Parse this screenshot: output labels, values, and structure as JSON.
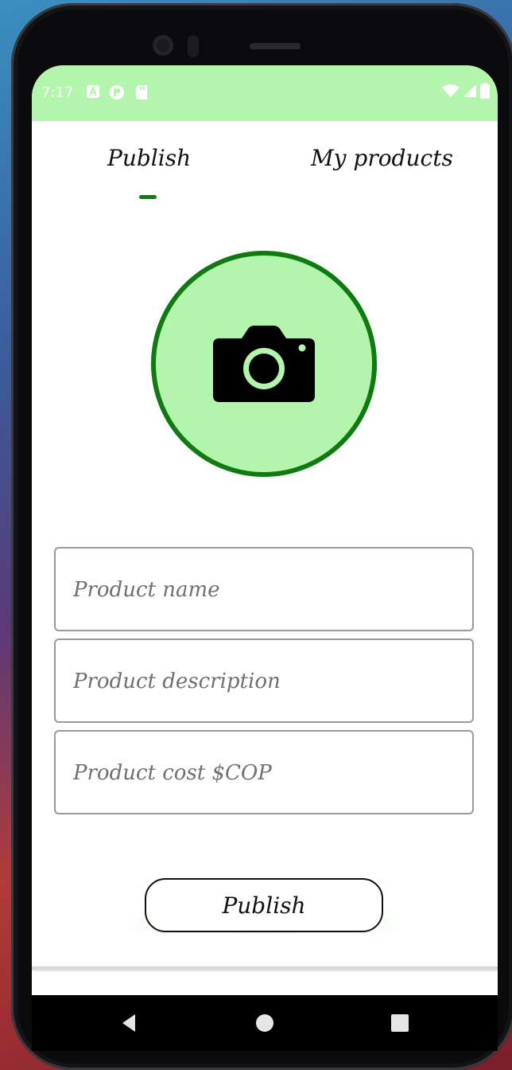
{
  "status_bar": {
    "time": "7:17",
    "left_icons": [
      "a-notification-icon",
      "p-notification-icon",
      "sd-card-icon"
    ],
    "right_icons": [
      "wifi-icon",
      "cell-signal-icon",
      "battery-icon"
    ],
    "background_color": "#b4f5ae"
  },
  "tabs": [
    {
      "label": "Publish",
      "selected": true
    },
    {
      "label": "My products",
      "selected": false
    }
  ],
  "photo_picker": {
    "icon": "camera-icon",
    "background_color": "#b4f5ae",
    "border_color": "#0f7a0f"
  },
  "form": {
    "name_placeholder": "Product name",
    "name_value": "",
    "description_placeholder": "Product description",
    "description_value": "",
    "cost_placeholder": "Product cost $COP",
    "cost_value": ""
  },
  "publish_button": {
    "label": "Publish"
  },
  "nav_bar": {
    "buttons": [
      "back-icon",
      "home-icon",
      "recents-icon"
    ]
  },
  "colors": {
    "accent_green": "#117a11",
    "light_green": "#b4f5ae"
  }
}
